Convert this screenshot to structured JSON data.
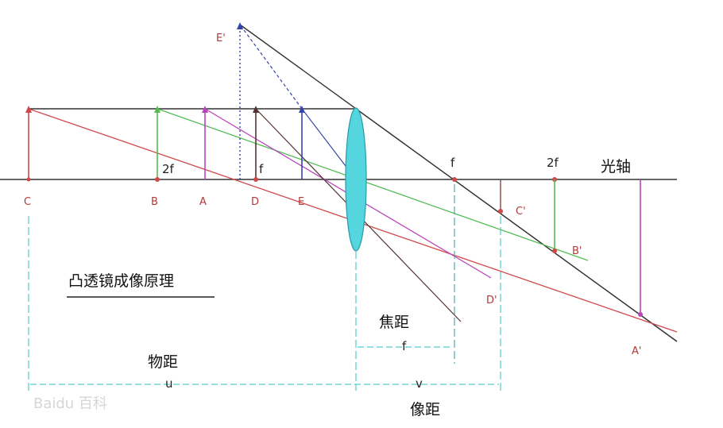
{
  "title": "凸透镜成像原理",
  "axis_label": "光轴",
  "object_points": {
    "C": "C",
    "B": "B",
    "A": "A",
    "D": "D",
    "E": "E"
  },
  "near_labels": {
    "two_f": "2f",
    "f": "f"
  },
  "far_labels": {
    "f": "f",
    "two_f": "2f"
  },
  "images": {
    "C": "C'",
    "B": "B'",
    "D": "D'",
    "A": "A'",
    "E": "E'"
  },
  "distances": {
    "focal": "焦距",
    "focal_symbol": "f",
    "object": "物距",
    "object_symbol": "u",
    "image": "像距",
    "image_symbol": "v"
  },
  "watermark": "Baidu 百科",
  "colors": {
    "object_red": "#d04848",
    "green": "#55bb55",
    "magenta": "#bb44bb",
    "dark": "#442222",
    "blue": "#3344aa",
    "lens": "#55d6df",
    "cyan_guide": "#55cccc",
    "axis": "#333333"
  }
}
